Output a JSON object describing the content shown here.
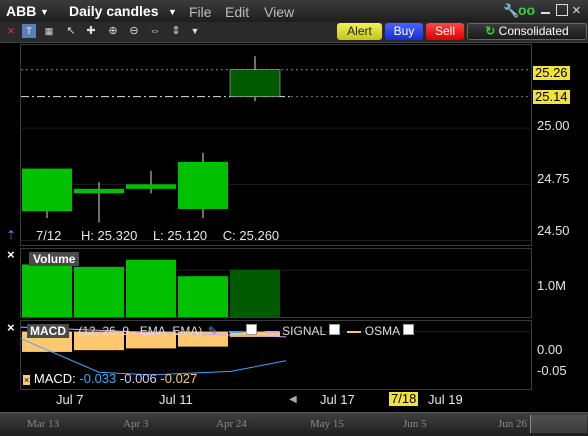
{
  "title_bar": {
    "symbol": "ABB",
    "period": "Daily candles",
    "menus": [
      "File",
      "Edit",
      "View"
    ]
  },
  "toolbar": {
    "alert_label": "Alert",
    "buy_label": "Buy",
    "sell_label": "Sell",
    "consolidated_label": "Consolidated",
    "tool_icons": [
      "close-icon",
      "link-icon",
      "cursor-icon",
      "crosshair-icon",
      "zoom-in-icon",
      "zoom-out-icon",
      "pan-icon",
      "expand-icon",
      "dropdown-icon"
    ]
  },
  "colors": {
    "up_candle": "#00c000",
    "down_candle": "#005a00",
    "price_tag_yellow": "#f2e33b",
    "macd_line": "#3fa9f5",
    "signal_line": "#c8a8ff",
    "osma_bar": "#ffc870",
    "axis_text": "#e6e6e6"
  },
  "price_panel": {
    "y_ticks": [
      "25.00",
      "24.75",
      "24.50"
    ],
    "current_price_tags": [
      "25.26",
      "25.14"
    ],
    "ohlc_readout": {
      "date": "7/12",
      "high": "H: 25.320",
      "low": "L: 25.120",
      "close": "C: 25.260"
    }
  },
  "volume_panel": {
    "label": "Volume",
    "y_tick": "1.0M"
  },
  "macd_panel": {
    "label": "MACD",
    "params": "(12, 26, 9 - EMA, EMA)",
    "legend_signal": "SIGNAL",
    "legend_osma": "OSMA",
    "y_ticks": [
      "0.00",
      "-0.05"
    ],
    "readout_prefix": "MACD:",
    "readout_values": [
      "-0.033",
      "-0.006",
      "-0.027"
    ]
  },
  "x_axis": {
    "labels": [
      "Jul 7",
      "Jul 11",
      "Jul 17",
      "7/18",
      "Jul 19"
    ]
  },
  "navigator": {
    "labels": [
      "Mar 13",
      "Apr 3",
      "Apr 24",
      "May 15",
      "Jun 5",
      "Jun 26"
    ]
  },
  "chart_data": {
    "type": "candlestick",
    "price_candles": [
      {
        "open": 24.82,
        "high": 24.82,
        "low": 24.6,
        "close": 24.63,
        "direction": "up"
      },
      {
        "open": 24.73,
        "high": 24.76,
        "low": 24.58,
        "close": 24.71,
        "direction": "up"
      },
      {
        "open": 24.75,
        "high": 24.81,
        "low": 24.71,
        "close": 24.73,
        "direction": "up"
      },
      {
        "open": 24.64,
        "high": 24.89,
        "low": 24.6,
        "close": 24.85,
        "direction": "up"
      },
      {
        "open": 25.14,
        "high": 25.32,
        "low": 25.12,
        "close": 25.26,
        "direction": "down"
      }
    ],
    "volume_millions": [
      1.12,
      1.07,
      1.22,
      0.87,
      1.01
    ],
    "osma_values": [
      -0.023,
      -0.021,
      -0.019,
      -0.017,
      -0.006
    ],
    "price_ylim": [
      24.48,
      25.37
    ],
    "volume_ylim": [
      0,
      1.45
    ],
    "macd_ylim": [
      -0.065,
      0.012
    ]
  }
}
